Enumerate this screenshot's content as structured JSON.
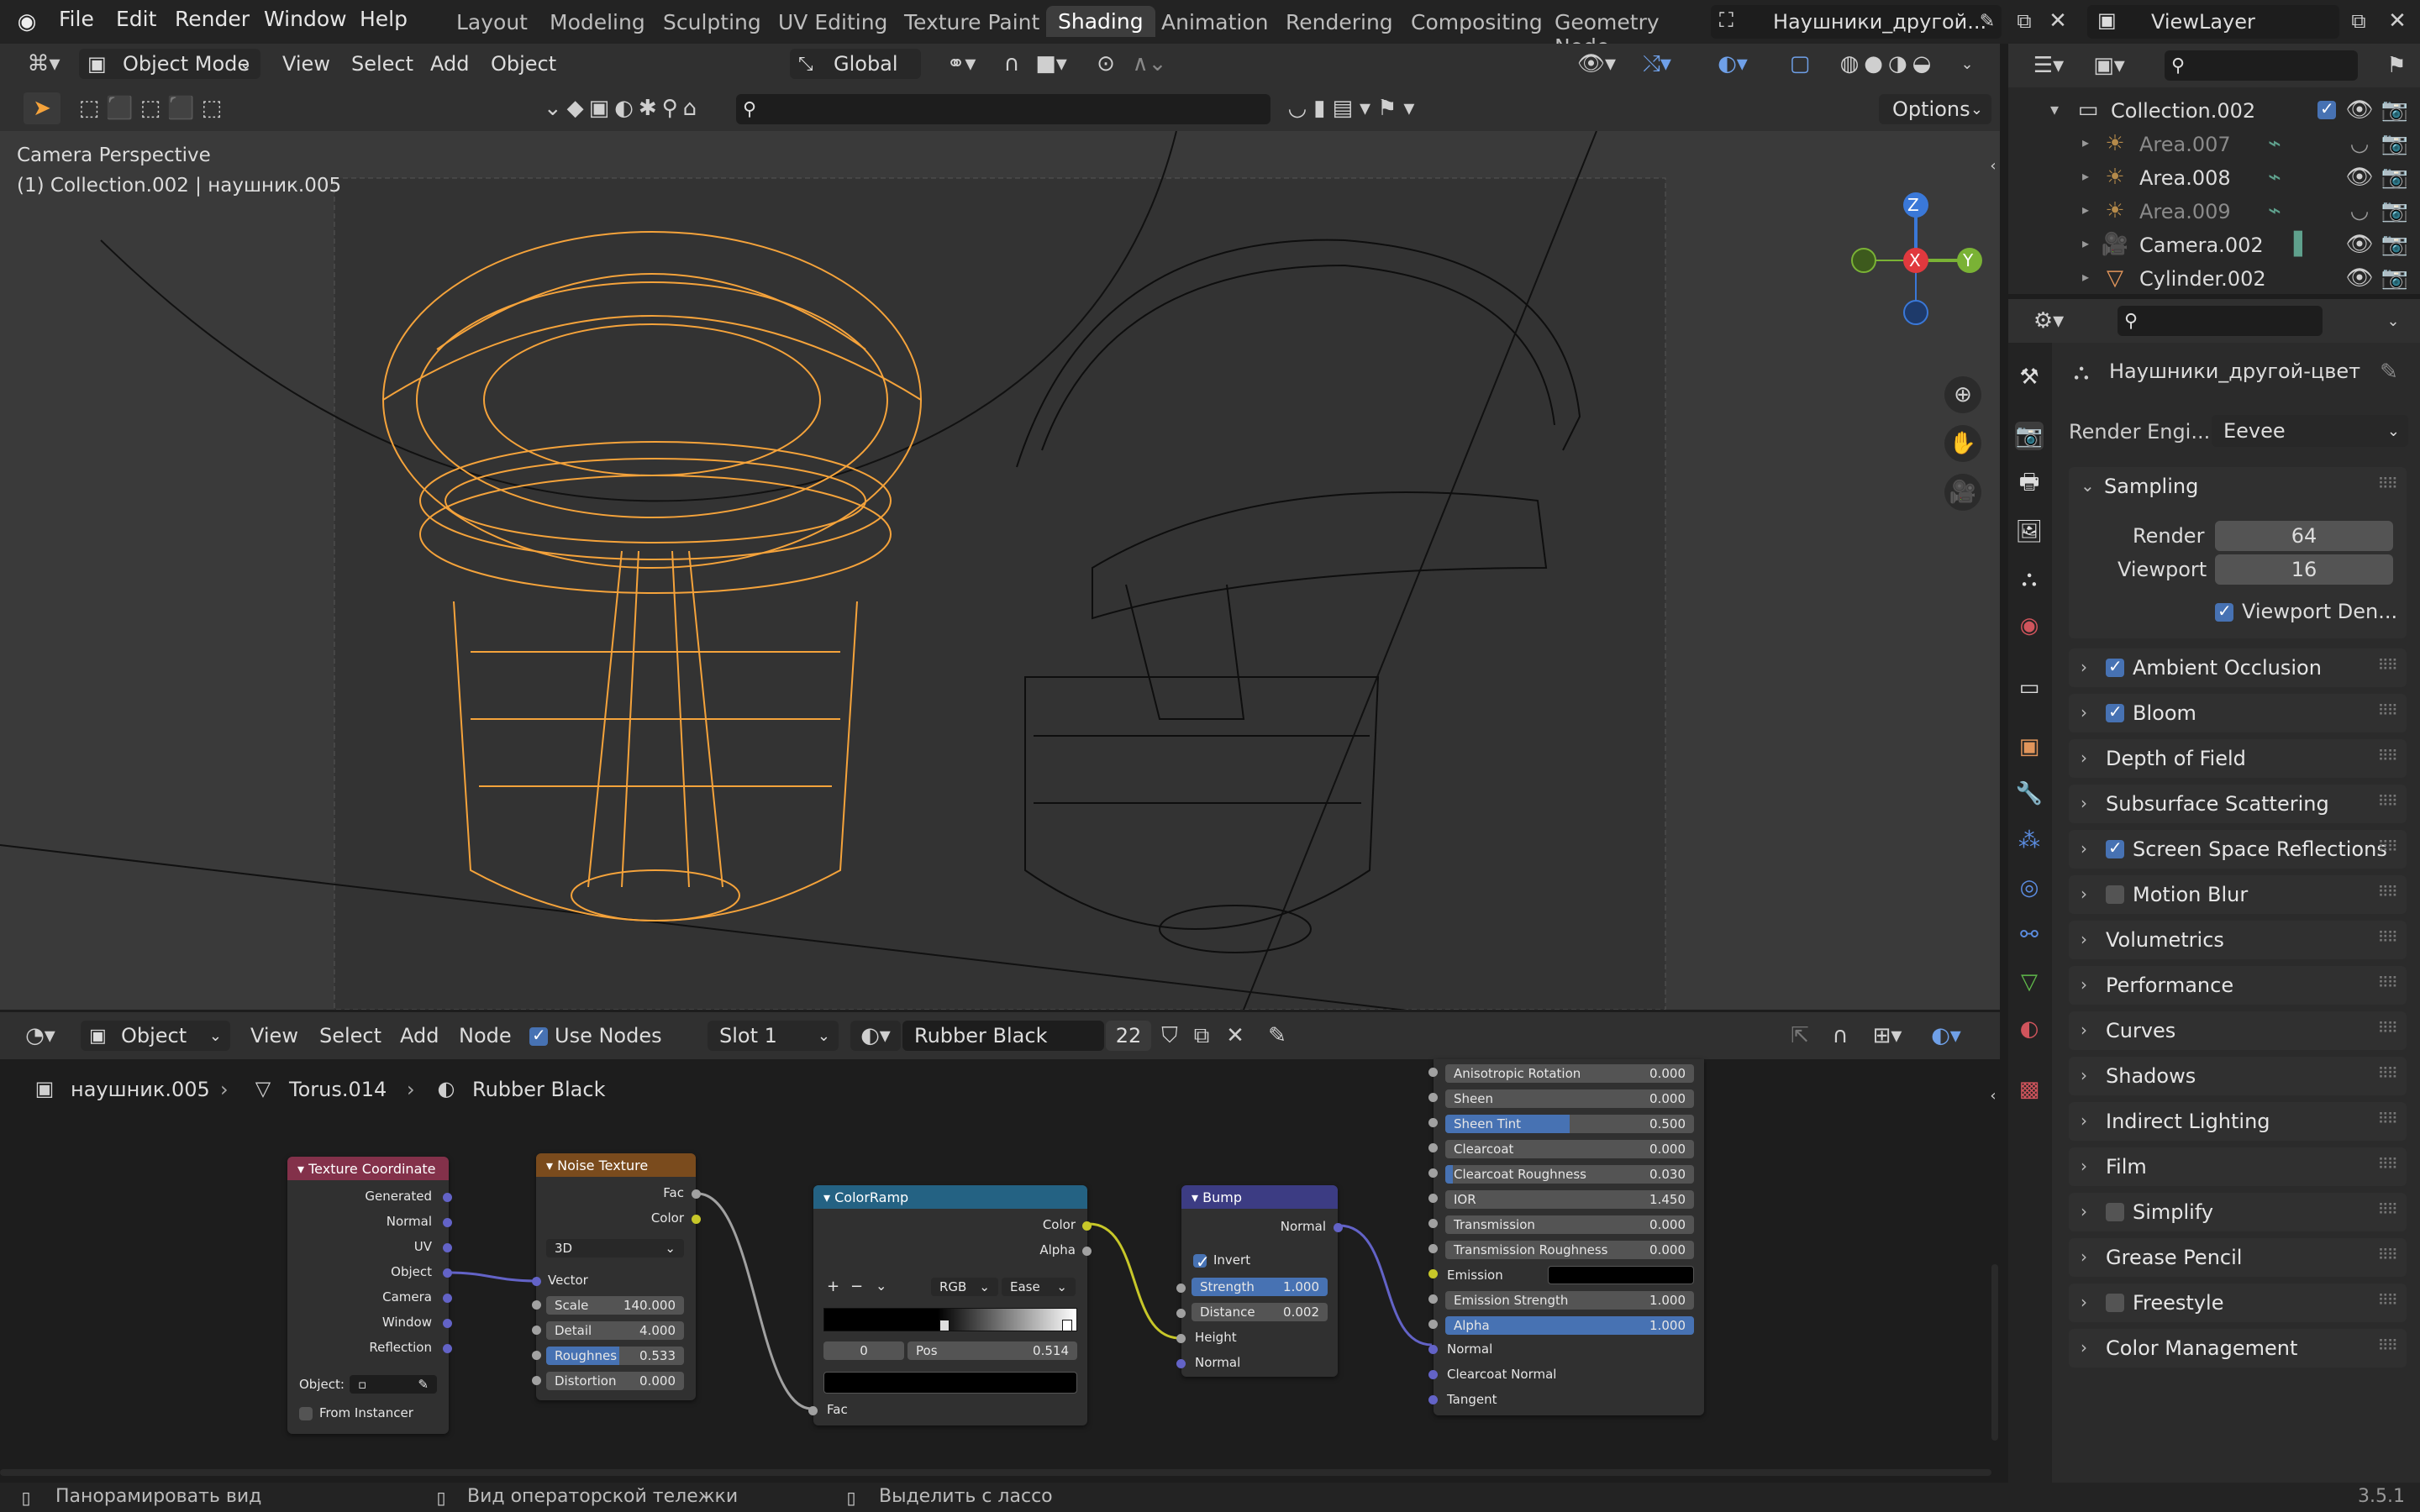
{
  "topbar": {
    "menus": [
      "File",
      "Edit",
      "Render",
      "Window",
      "Help"
    ],
    "workspaces": [
      "Layout",
      "Modeling",
      "Sculpting",
      "UV Editing",
      "Texture Paint",
      "Shading",
      "Animation",
      "Rendering",
      "Compositing",
      "Geometry Node"
    ],
    "active_workspace": "Shading",
    "scene_name": "Наушники_другой...",
    "view_layer": "ViewLayer"
  },
  "viewport": {
    "mode": "Object Mode",
    "menus": [
      "View",
      "Select",
      "Add",
      "Object"
    ],
    "orientation": "Global",
    "options": "Options",
    "overlay_title": "Camera Perspective",
    "overlay_sub": "(1) Collection.002 | наушник.005",
    "gizmo": {
      "z": "Z",
      "x": "X",
      "y": "Y"
    }
  },
  "node_editor": {
    "editor_type": "Object",
    "menus": [
      "View",
      "Select",
      "Add",
      "Node"
    ],
    "use_nodes": "Use Nodes",
    "slot": "Slot 1",
    "material": "Rubber Black",
    "users": "22",
    "breadcrumb": [
      "наушник.005",
      "Torus.014",
      "Rubber Black"
    ],
    "nodes": {
      "texcoord": {
        "title": "Texture Coordinate",
        "outputs": [
          "Generated",
          "Normal",
          "UV",
          "Object",
          "Camera",
          "Window",
          "Reflection"
        ],
        "object_label": "Object:",
        "from_instancer": "From Instancer"
      },
      "noise": {
        "title": "Noise Texture",
        "outputs": [
          "Fac",
          "Color"
        ],
        "dim": "3D",
        "vector": "Vector",
        "scale_l": "Scale",
        "scale_v": "140.000",
        "detail_l": "Detail",
        "detail_v": "4.000",
        "rough_l": "Roughnes",
        "rough_v": "0.533",
        "dist_l": "Distortion",
        "dist_v": "0.000"
      },
      "ramp": {
        "title": "ColorRamp",
        "outputs": [
          "Color",
          "Alpha"
        ],
        "mode": "RGB",
        "interp": "Ease",
        "index": "0",
        "pos_l": "Pos",
        "pos_v": "0.514",
        "input": "Fac"
      },
      "bump": {
        "title": "Bump",
        "output": "Normal",
        "invert": "Invert",
        "strength_l": "Strength",
        "strength_v": "1.000",
        "distance_l": "Distance",
        "distance_v": "0.002",
        "inputs": [
          "Height",
          "Normal"
        ]
      },
      "bsdf": {
        "rows": [
          [
            "Anisotropic Rotation",
            "0.000"
          ],
          [
            "Sheen",
            "0.000"
          ],
          [
            "Sheen Tint",
            "0.500"
          ],
          [
            "Clearcoat",
            "0.000"
          ],
          [
            "Clearcoat Roughness",
            "0.030"
          ],
          [
            "IOR",
            "1.450"
          ],
          [
            "Transmission",
            "0.000"
          ],
          [
            "Transmission Roughness",
            "0.000"
          ]
        ],
        "emission": "Emission",
        "emission_strength_l": "Emission Strength",
        "emission_strength_v": "1.000",
        "alpha_l": "Alpha",
        "alpha_v": "1.000",
        "inputs": [
          "Normal",
          "Clearcoat Normal",
          "Tangent"
        ]
      }
    }
  },
  "outliner": {
    "items": [
      {
        "name": "Collection.002",
        "level": 0
      },
      {
        "name": "Area.007",
        "level": 1,
        "dim": true
      },
      {
        "name": "Area.008",
        "level": 1,
        "dim": false
      },
      {
        "name": "Area.009",
        "level": 1,
        "dim": true
      },
      {
        "name": "Camera.002",
        "level": 1,
        "dim": false
      },
      {
        "name": "Cylinder.002",
        "level": 1,
        "dim": false
      }
    ]
  },
  "properties": {
    "scene": "Наушники_другой-цвет",
    "render_engine_label": "Render Engi...",
    "render_engine": "Eevee",
    "sampling": {
      "title": "Sampling",
      "render_l": "Render",
      "render_v": "64",
      "viewport_l": "Viewport",
      "viewport_v": "16",
      "denoise": "Viewport Den..."
    },
    "panels": [
      {
        "label": "Ambient Occlusion",
        "checkbox": true
      },
      {
        "label": "Bloom",
        "checkbox": true
      },
      {
        "label": "Depth of Field",
        "checkbox": null
      },
      {
        "label": "Subsurface Scattering",
        "checkbox": null
      },
      {
        "label": "Screen Space Reflections",
        "checkbox": true
      },
      {
        "label": "Motion Blur",
        "checkbox": false
      },
      {
        "label": "Volumetrics",
        "checkbox": null
      },
      {
        "label": "Performance",
        "checkbox": null
      },
      {
        "label": "Curves",
        "checkbox": null
      },
      {
        "label": "Shadows",
        "checkbox": null
      },
      {
        "label": "Indirect Lighting",
        "checkbox": null
      },
      {
        "label": "Film",
        "checkbox": null
      },
      {
        "label": "Simplify",
        "checkbox": false
      },
      {
        "label": "Grease Pencil",
        "checkbox": null
      },
      {
        "label": "Freestyle",
        "checkbox": false
      },
      {
        "label": "Color Management",
        "checkbox": null
      }
    ]
  },
  "statusbar": {
    "hint1": "Панорамировать вид",
    "hint2": "Вид операторской тележки",
    "hint3": "Выделить с лассо",
    "version": "3.5.1"
  },
  "colors": {
    "accent": "#4772b3",
    "selected_wire": "#f5a33b",
    "header": "#303030"
  }
}
